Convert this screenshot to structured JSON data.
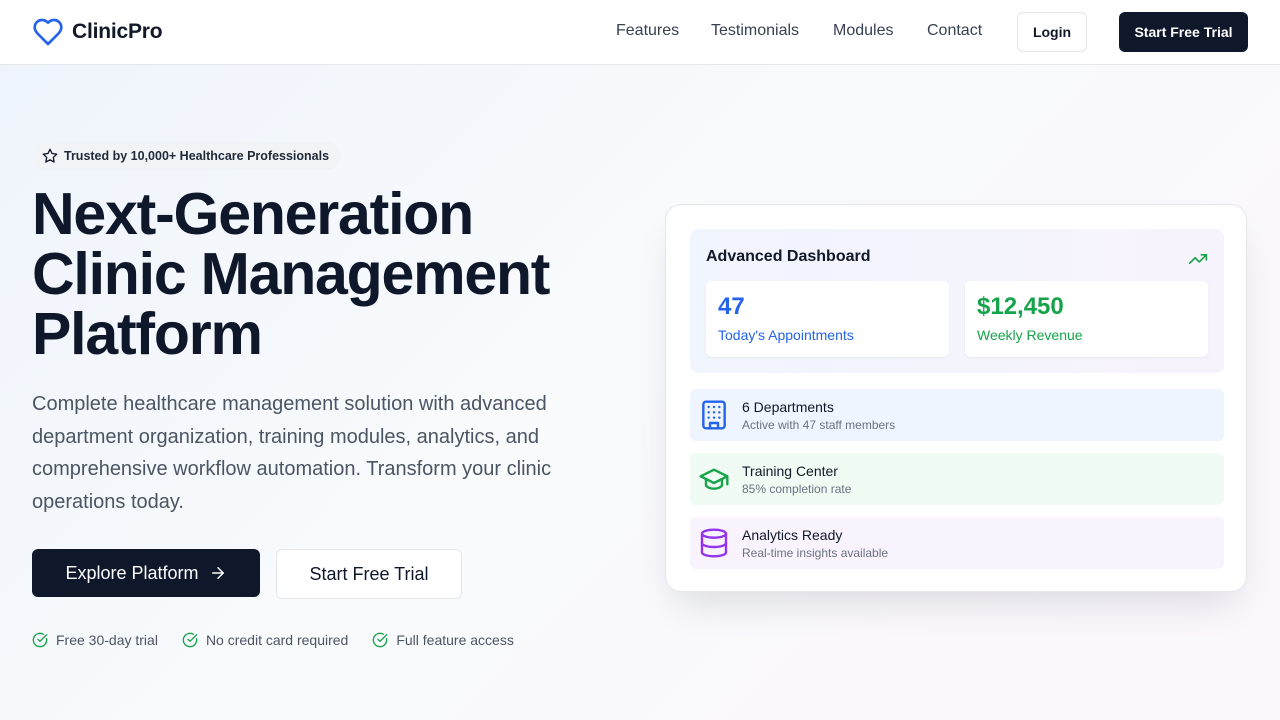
{
  "header": {
    "logo_text": "ClinicPro",
    "nav": [
      "Features",
      "Testimonials",
      "Modules",
      "Contact"
    ],
    "login_label": "Login",
    "trial_label": "Start Free Trial"
  },
  "hero": {
    "badge": "Trusted by 10,000+ Healthcare Professionals",
    "title_lines": [
      "Next-Generation",
      "Clinic Management",
      "Platform"
    ],
    "description": "Complete healthcare management solution with advanced department organization, training modules, analytics, and comprehensive workflow automation. Transform your clinic operations today.",
    "explore_label": "Explore Platform",
    "start_label": "Start Free Trial",
    "perks": [
      "Free 30-day trial",
      "No credit card required",
      "Full feature access"
    ]
  },
  "dashboard": {
    "title": "Advanced Dashboard",
    "stats": [
      {
        "value": "47",
        "label": "Today's Appointments"
      },
      {
        "value": "$12,450",
        "label": "Weekly Revenue"
      }
    ],
    "rows": [
      {
        "title": "6 Departments",
        "subtitle": "Active with 47 staff members",
        "icon": "building-icon"
      },
      {
        "title": "Training Center",
        "subtitle": "85% completion rate",
        "icon": "graduation-cap-icon"
      },
      {
        "title": "Analytics Ready",
        "subtitle": "Real-time insights available",
        "icon": "database-icon"
      }
    ]
  },
  "colors": {
    "brand_blue": "#2563eb",
    "success_green": "#16a34a",
    "analytics_purple": "#9333ea",
    "primary_dark": "#0f172a"
  }
}
